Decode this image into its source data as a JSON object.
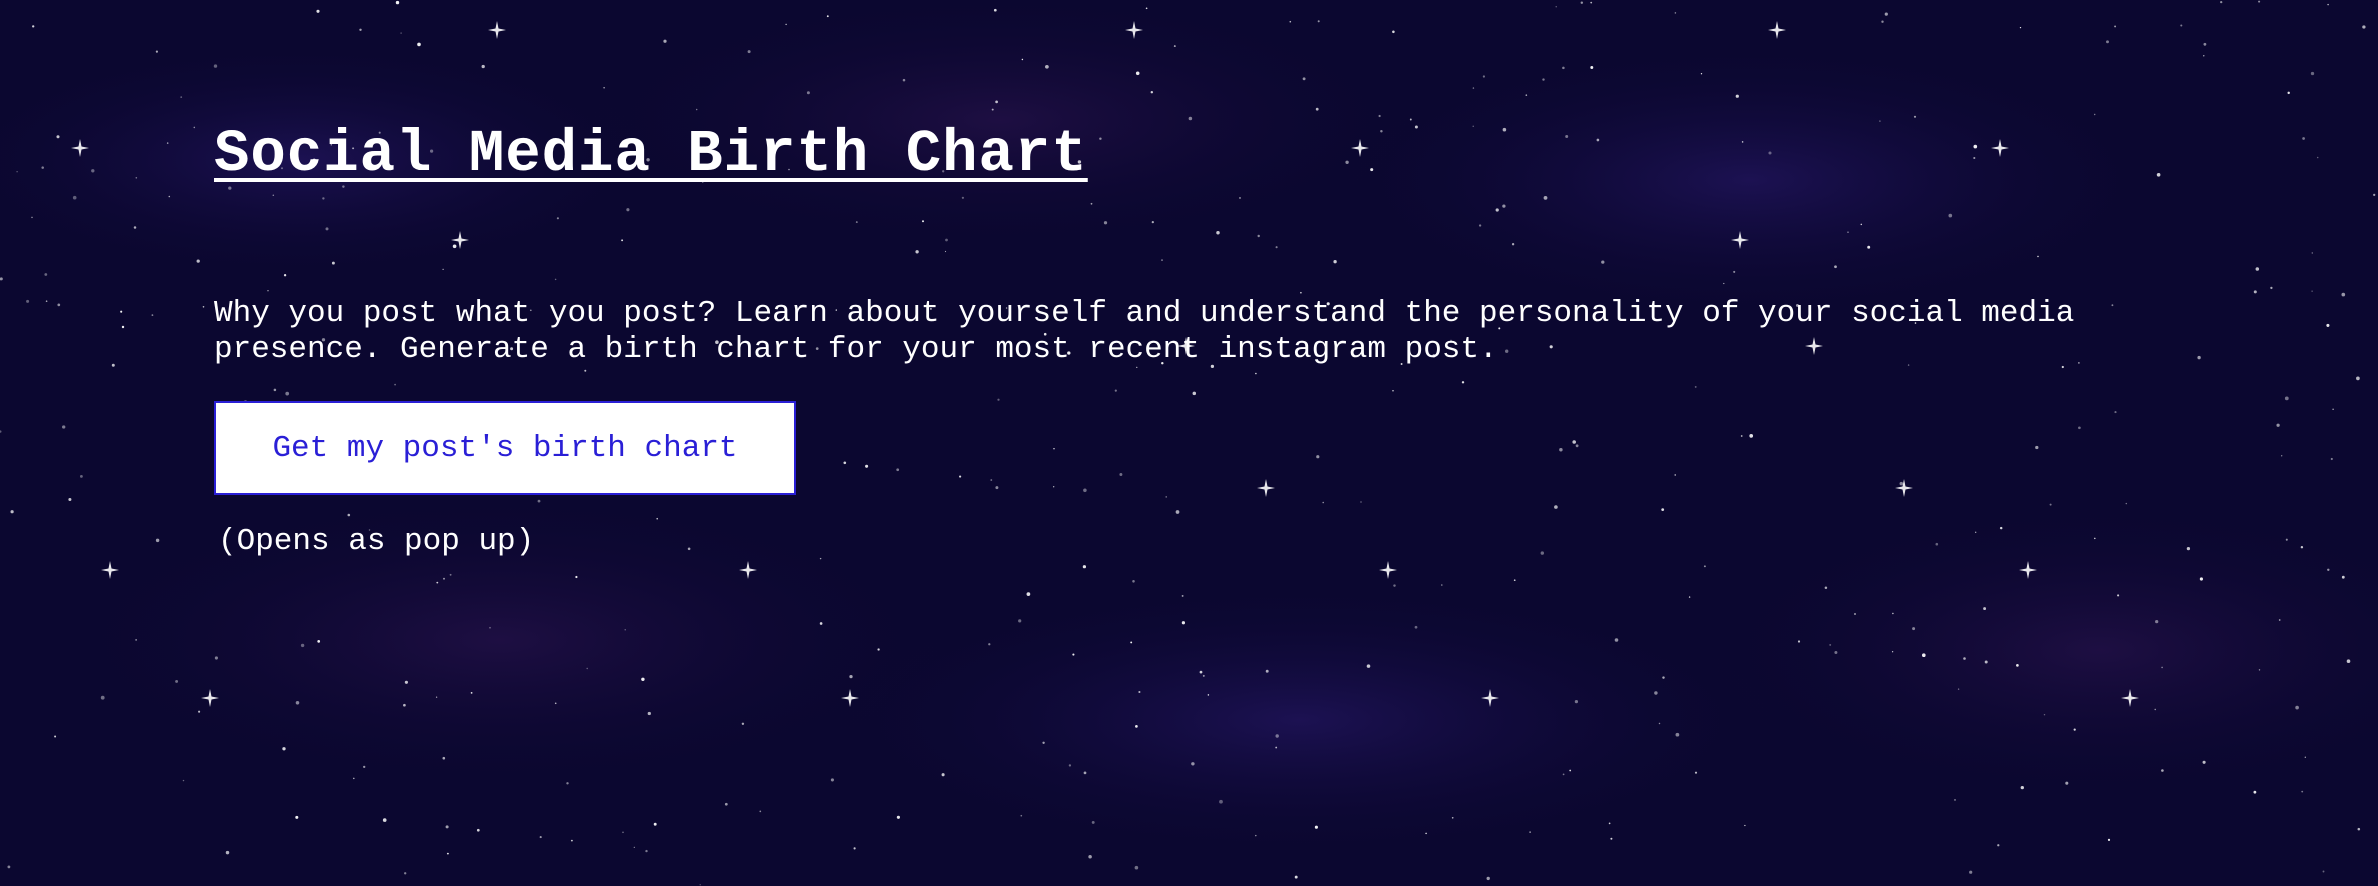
{
  "page": {
    "title": "Social Media Birth Chart",
    "intro": "Why you post what you post? Learn about yourself and understand the personality of your social media presence. Generate a birth chart for your most recent instagram post.",
    "button_label": "Get my post's birth chart",
    "popup_note": "(Opens as pop up)"
  },
  "theme": {
    "background": "#0b0730",
    "text": "#ffffff",
    "button_text": "#2a1fd6",
    "button_border": "#2a1fd6",
    "star": "#ffffff"
  }
}
